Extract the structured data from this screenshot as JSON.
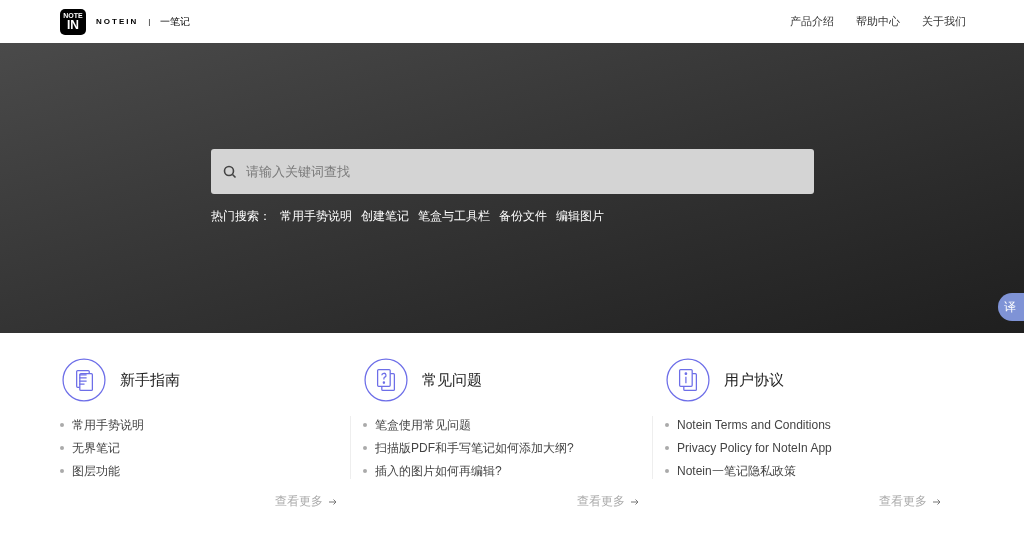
{
  "header": {
    "logo": {
      "top": "NOTE",
      "bottom": "IN"
    },
    "brand": "NOTEIN",
    "separator": "|",
    "brand_cn": "一笔记",
    "nav": [
      "产品介绍",
      "帮助中心",
      "关于我们"
    ]
  },
  "hero": {
    "search": {
      "placeholder": "请输入关键词查找"
    },
    "hot_label": "热门搜索：",
    "hot": [
      "常用手势说明",
      "创建笔记",
      "笔盒与工具栏",
      "备份文件",
      "编辑图片"
    ]
  },
  "translate_button": "译",
  "sections": [
    {
      "kind": "document",
      "title": "新手指南",
      "items": [
        "常用手势说明",
        "无界笔记",
        "图层功能"
      ],
      "more": "查看更多"
    },
    {
      "kind": "question",
      "title": "常见问题",
      "items": [
        "笔盒使用常见问题",
        "扫描版PDF和手写笔记如何添加大纲?",
        "插入的图片如何再编辑?"
      ],
      "more": "查看更多"
    },
    {
      "kind": "info",
      "title": "用户协议",
      "items": [
        "Notein Terms and Conditions",
        "Privacy Policy for NoteIn App",
        "Notein一笔记隐私政策"
      ],
      "more": "查看更多"
    }
  ]
}
